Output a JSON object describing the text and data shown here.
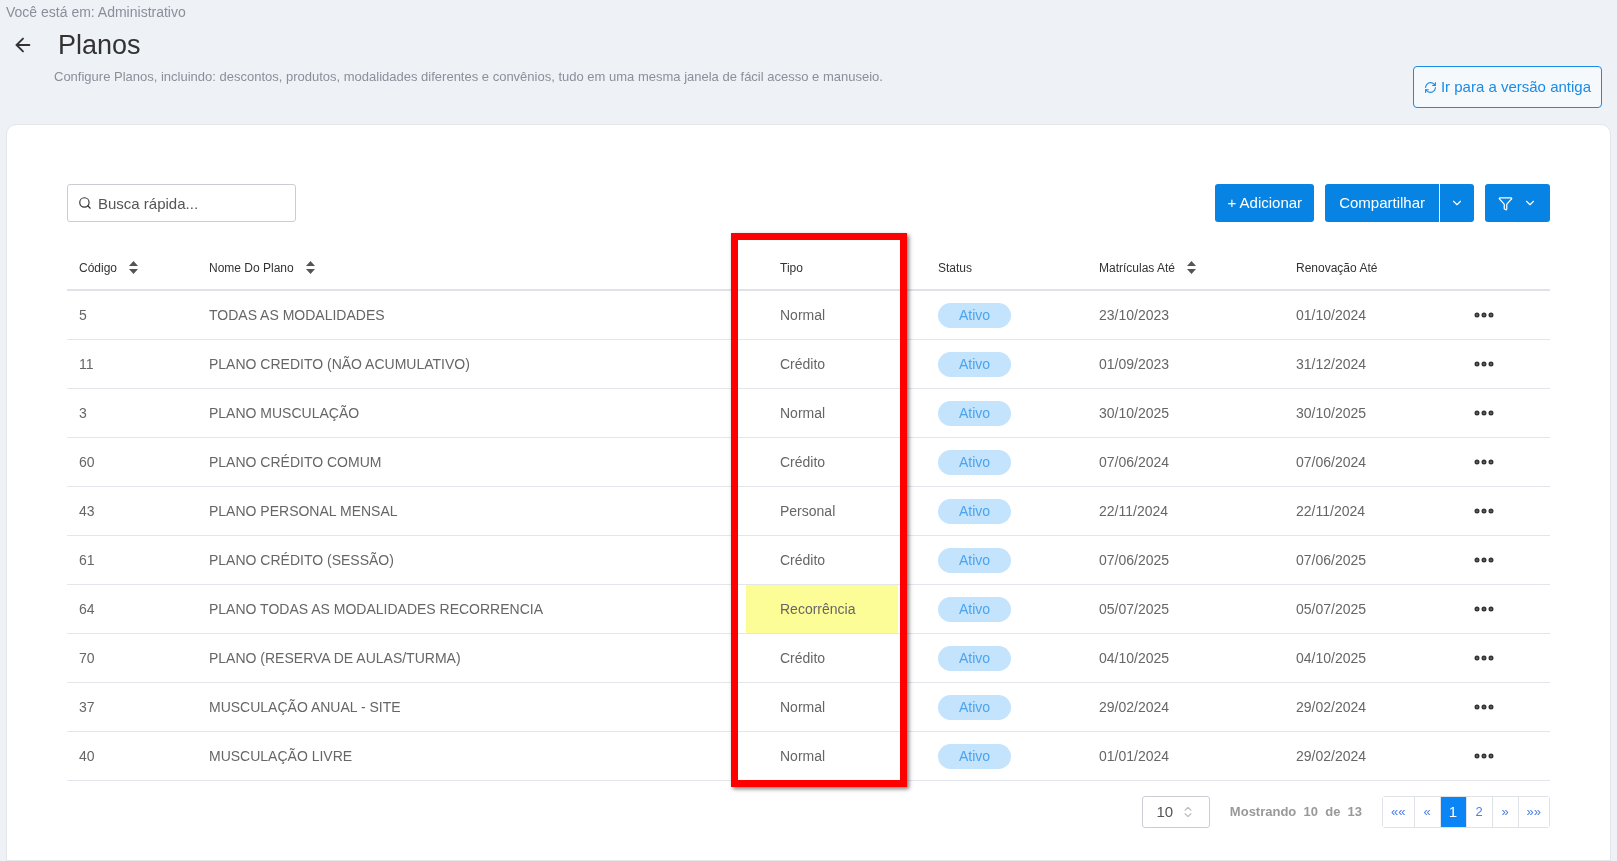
{
  "breadcrumb": "Você está em: Administrativo",
  "title": "Planos",
  "description": "Configure Planos, incluindo: descontos, produtos, modalidades diferentes e convênios, tudo em uma mesma janela de fácil acesso e manuseio.",
  "old_version_button": "Ir para a versão antiga",
  "search": {
    "placeholder": "Busca rápida..."
  },
  "add_button": "+ Adicionar",
  "share_button": "Compartilhar",
  "columns": [
    {
      "label": "Código",
      "sortable": true
    },
    {
      "label": "Nome Do Plano",
      "sortable": true
    },
    {
      "label": "Tipo",
      "sortable": false
    },
    {
      "label": "Status",
      "sortable": false
    },
    {
      "label": "Matrículas Até",
      "sortable": true
    },
    {
      "label": "Renovação Até",
      "sortable": false
    }
  ],
  "rows": [
    {
      "code": "5",
      "name": "TODAS AS MODALIDADES",
      "type": "Normal",
      "highlighted": false,
      "status": "Ativo",
      "enrollment_until": "23/10/2023",
      "renewal_until": "01/10/2024"
    },
    {
      "code": "11",
      "name": "PLANO CREDITO (NÃO ACUMULATIVO)",
      "type": "Crédito",
      "highlighted": false,
      "status": "Ativo",
      "enrollment_until": "01/09/2023",
      "renewal_until": "31/12/2024"
    },
    {
      "code": "3",
      "name": "PLANO MUSCULAÇÃO",
      "type": "Normal",
      "highlighted": false,
      "status": "Ativo",
      "enrollment_until": "30/10/2025",
      "renewal_until": "30/10/2025"
    },
    {
      "code": "60",
      "name": "PLANO CRÉDITO COMUM",
      "type": "Crédito",
      "highlighted": false,
      "status": "Ativo",
      "enrollment_until": "07/06/2024",
      "renewal_until": "07/06/2024"
    },
    {
      "code": "43",
      "name": "PLANO PERSONAL MENSAL",
      "type": "Personal",
      "highlighted": false,
      "status": "Ativo",
      "enrollment_until": "22/11/2024",
      "renewal_until": "22/11/2024"
    },
    {
      "code": "61",
      "name": "PLANO CRÉDITO (SESSÃO)",
      "type": "Crédito",
      "highlighted": false,
      "status": "Ativo",
      "enrollment_until": "07/06/2025",
      "renewal_until": "07/06/2025"
    },
    {
      "code": "64",
      "name": "PLANO TODAS AS MODALIDADES RECORRENCIA",
      "type": "Recorrência",
      "highlighted": true,
      "status": "Ativo",
      "enrollment_until": "05/07/2025",
      "renewal_until": "05/07/2025"
    },
    {
      "code": "70",
      "name": "PLANO (RESERVA DE AULAS/TURMA)",
      "type": "Crédito",
      "highlighted": false,
      "status": "Ativo",
      "enrollment_until": "04/10/2025",
      "renewal_until": "04/10/2025"
    },
    {
      "code": "37",
      "name": "MUSCULAÇÃO ANUAL - SITE",
      "type": "Normal",
      "highlighted": false,
      "status": "Ativo",
      "enrollment_until": "29/02/2024",
      "renewal_until": "29/02/2024"
    },
    {
      "code": "40",
      "name": "MUSCULAÇÃO LIVRE",
      "type": "Normal",
      "highlighted": false,
      "status": "Ativo",
      "enrollment_until": "01/01/2024",
      "renewal_until": "29/02/2024"
    }
  ],
  "page_size": "10",
  "showing": "Mostrando  10  de  13",
  "pages": [
    {
      "label": "««",
      "selected": false
    },
    {
      "label": "«",
      "selected": false
    },
    {
      "label": "1",
      "selected": true
    },
    {
      "label": "2",
      "selected": false
    },
    {
      "label": "»",
      "selected": false
    },
    {
      "label": "»»",
      "selected": false
    }
  ]
}
